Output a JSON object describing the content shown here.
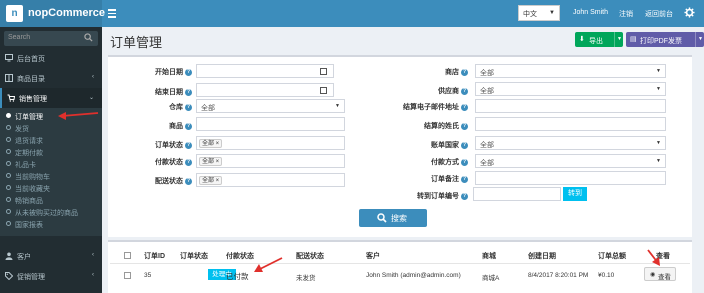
{
  "header": {
    "brand": "nopCommerce",
    "logo_letter": "n",
    "language": "中文",
    "user": "John Smith",
    "logout": "注销",
    "back_to_store": "返回前台"
  },
  "sidebar": {
    "search_placeholder": "Search",
    "items": [
      {
        "label": "后台首页",
        "icon": "desktop-icon"
      },
      {
        "label": "商品目录",
        "icon": "book-icon"
      },
      {
        "label": "销售管理",
        "icon": "cart-icon"
      },
      {
        "label": "客户",
        "icon": "user-icon"
      },
      {
        "label": "促销管理",
        "icon": "tags-icon"
      }
    ],
    "sales_submenu": [
      "订单管理",
      "发货",
      "退货请求",
      "定期付款",
      "礼品卡",
      "当前购物车",
      "当前收藏夹",
      "畅销商品",
      "从未被购买过的商品",
      "国家报表"
    ],
    "active_submenu": "订单管理"
  },
  "page": {
    "title": "订单管理",
    "export_label": "导出",
    "print_pdf_label": "打印PDF发票"
  },
  "filters": {
    "start_date_label": "开始日期",
    "end_date_label": "结束日期",
    "warehouse_label": "仓库",
    "warehouse_value": "全部",
    "product_label": "商品",
    "order_status_label": "订单状态",
    "order_status_value": "全部",
    "payment_status_label": "付款状态",
    "payment_status_value": "全部",
    "shipping_status_label": "配送状态",
    "shipping_status_value": "全部",
    "store_label": "商店",
    "store_value": "全部",
    "vendor_label": "供应商",
    "vendor_value": "全部",
    "billing_email_label": "结算电子邮件地址",
    "billing_lastname_label": "结算的姓氏",
    "billing_country_label": "账单国家",
    "billing_country_value": "全部",
    "payment_method_label": "付款方式",
    "payment_method_value": "全部",
    "order_notes_label": "订单备注",
    "goto_order_label": "转到订单编号",
    "goto_button": "转到",
    "search_button": "搜索"
  },
  "table": {
    "columns": [
      "订单ID",
      "订单状态",
      "付款状态",
      "配送状态",
      "客户",
      "商城",
      "创建日期",
      "订单总额",
      "查看"
    ],
    "rows": [
      {
        "id": "35",
        "order_status": "处理中",
        "payment_status": "已付款",
        "shipping_status": "未发货",
        "customer": "John Smith (admin@admin.com)",
        "store": "商城A",
        "created": "8/4/2017 8:20:01 PM",
        "total": "¥0.10",
        "view": "查看"
      }
    ]
  },
  "colors": {
    "header": "#3c8dbc",
    "sidebar": "#222d32",
    "export": "#00a65a",
    "pdf": "#605ca8",
    "info": "#00c0ef",
    "annotation": "#e0302c"
  }
}
